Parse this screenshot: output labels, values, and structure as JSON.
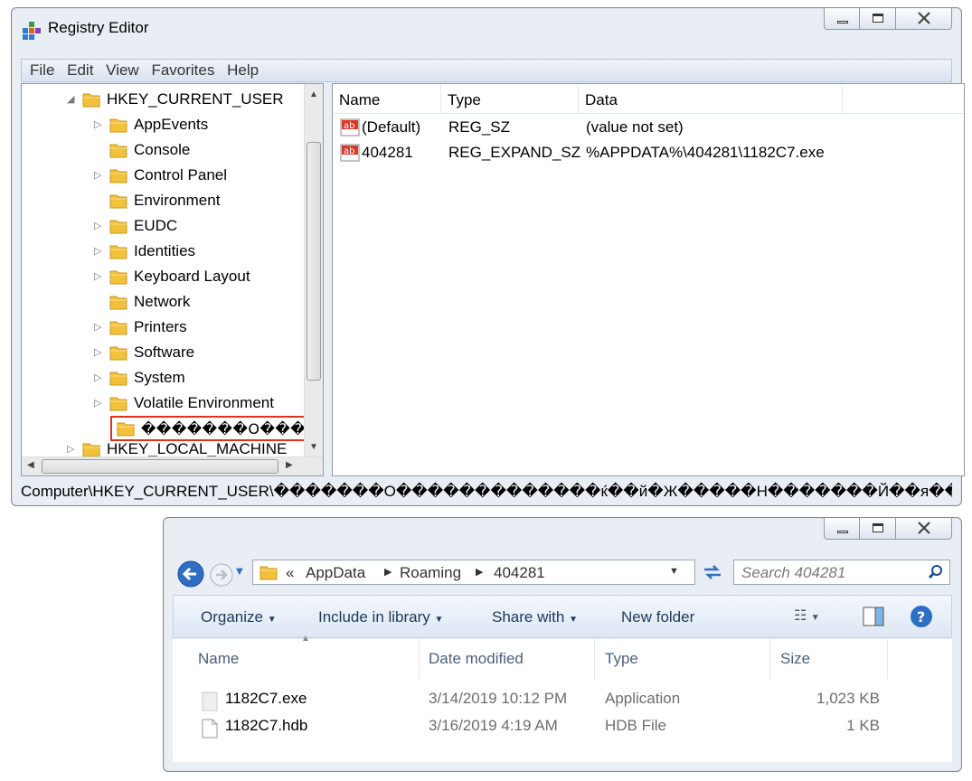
{
  "regedit": {
    "title": "Registry Editor",
    "menu": [
      "File",
      "Edit",
      "View",
      "Favorites",
      "Help"
    ],
    "tree": {
      "root": "HKEY_CURRENT_USER",
      "children": [
        {
          "label": "AppEvents",
          "expandable": true
        },
        {
          "label": "Console",
          "expandable": false
        },
        {
          "label": "Control Panel",
          "expandable": true
        },
        {
          "label": "Environment",
          "expandable": false
        },
        {
          "label": "EUDC",
          "expandable": true
        },
        {
          "label": "Identities",
          "expandable": true
        },
        {
          "label": "Keyboard Layout",
          "expandable": true
        },
        {
          "label": "Network",
          "expandable": false
        },
        {
          "label": "Printers",
          "expandable": true
        },
        {
          "label": "Software",
          "expandable": true
        },
        {
          "label": "System",
          "expandable": true
        },
        {
          "label": "Volatile Environment",
          "expandable": true
        }
      ],
      "selected_key": "�������O���",
      "next_root": "HKEY_LOCAL_MACHINE"
    },
    "columns": [
      "Name",
      "Type",
      "Data"
    ],
    "values": [
      {
        "name": "(Default)",
        "type": "REG_SZ",
        "data": "(value not set)"
      },
      {
        "name": "404281",
        "type": "REG_EXPAND_SZ",
        "data": "%APPDATA%\\404281\\1182C7.exe"
      }
    ],
    "status_path": "Computer\\HKEY_CURRENT_USER\\�������O�������������ќ��й�Ж�����Н�������Й��я��"
  },
  "explorer": {
    "address": {
      "prefix": "«",
      "crumbs": [
        "AppData",
        "Roaming",
        "404281"
      ]
    },
    "search_placeholder": "Search 404281",
    "toolbar": {
      "organize": "Organize",
      "include": "Include in library",
      "share": "Share with",
      "new_folder": "New folder"
    },
    "columns": [
      "Name",
      "Date modified",
      "Type",
      "Size"
    ],
    "files": [
      {
        "name": "1182C7.exe",
        "date": "3/14/2019 10:12 PM",
        "type": "Application",
        "size": "1,023 KB"
      },
      {
        "name": "1182C7.hdb",
        "date": "3/16/2019 4:19 AM",
        "type": "HDB File",
        "size": "1 KB"
      }
    ]
  },
  "colors": {
    "highlight_border": "#e0301e",
    "folder": "#f3c23c",
    "accent": "#1e395b"
  }
}
